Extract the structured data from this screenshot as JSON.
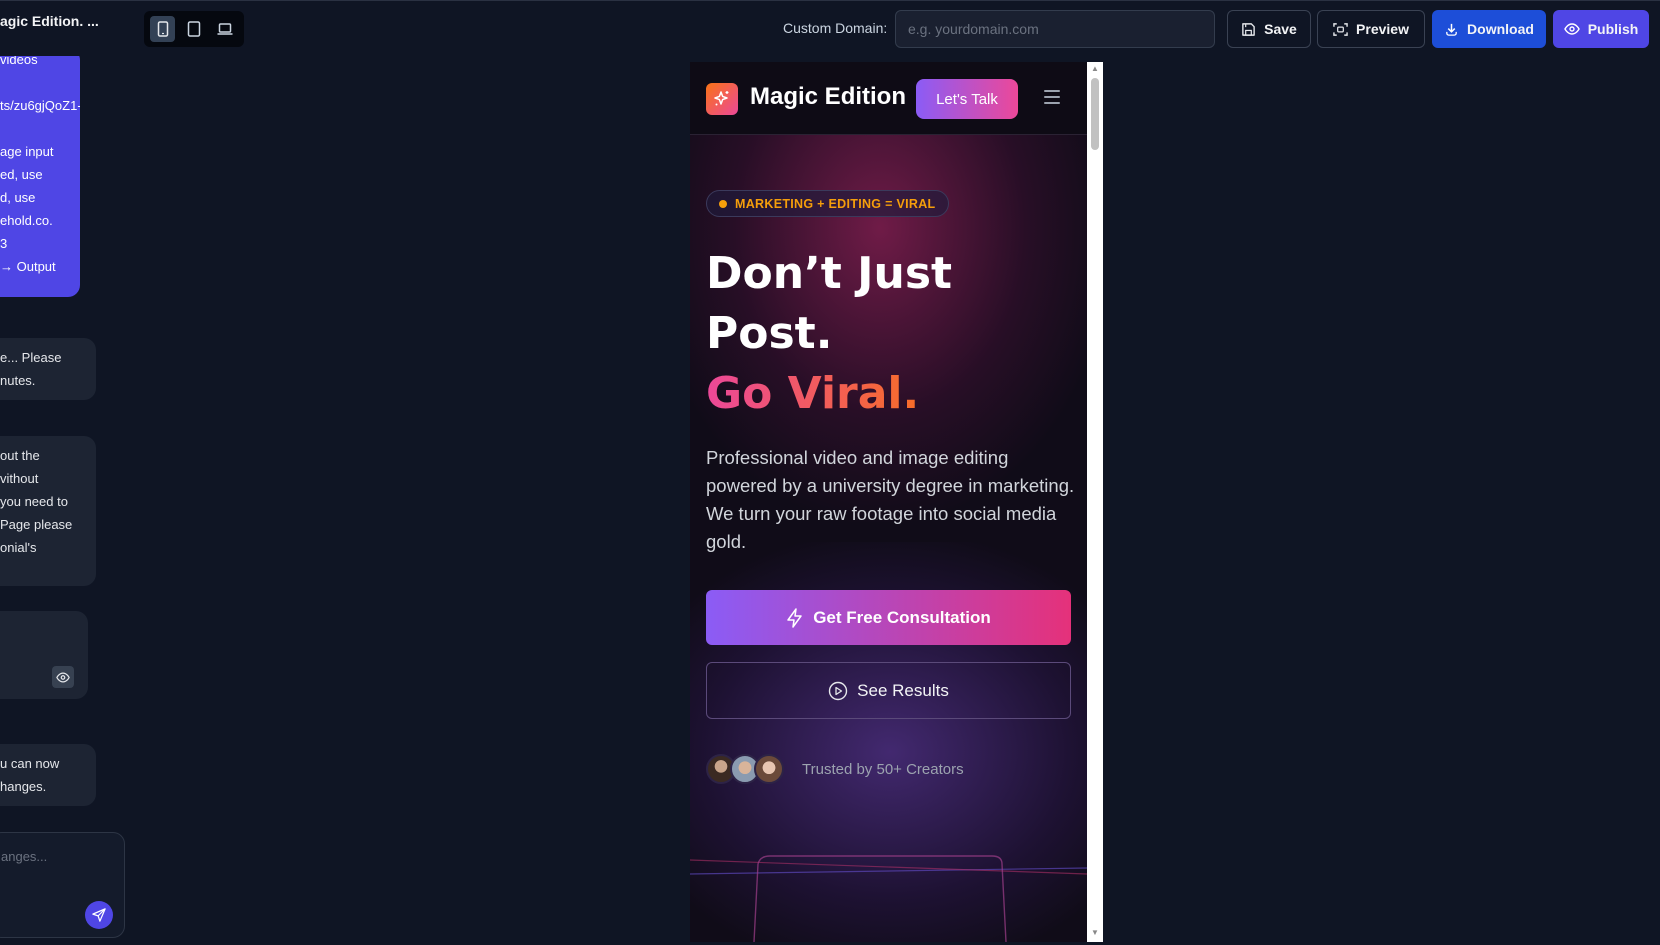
{
  "toolbar": {
    "project_title": "agic Edition. ...",
    "devices": [
      {
        "name": "mobile",
        "icon": "smartphone-icon",
        "active": true
      },
      {
        "name": "tablet",
        "icon": "tablet-icon",
        "active": false
      },
      {
        "name": "desktop",
        "icon": "laptop-icon",
        "active": false
      }
    ],
    "custom_domain_label": "Custom Domain:",
    "custom_domain_placeholder": "e.g. yourdomain.com",
    "custom_domain_value": "",
    "save_label": "Save",
    "preview_label": "Preview",
    "download_label": "Download",
    "publish_label": "Publish"
  },
  "chat": {
    "user_message_lines": [
      "videos",
      "",
      "ts/zu6gjQoZ1-",
      "",
      "age input",
      "ed, use",
      "d, use",
      "ehold.co.",
      "3",
      "→ Output"
    ],
    "ai_message_1_lines": [
      "e... Please",
      "nutes."
    ],
    "ai_message_2_lines": [
      "out the",
      "vithout",
      "you need to",
      "Page please",
      "onial's"
    ],
    "ai_message_4_lines": [
      "u can now",
      "hanges."
    ],
    "input_placeholder": "anges..."
  },
  "preview": {
    "brand": "Magic Edition",
    "nav_cta": "Let's Talk",
    "badge": "MARKETING + EDITING = VIRAL",
    "headline_line1": "Don’t Just",
    "headline_line2": "Post.",
    "headline_line3": "Go Viral.",
    "lead": "Professional video and image editing powered by a university degree in marketing. We turn your raw footage into social media gold.",
    "primary_cta": "Get Free Consultation",
    "secondary_cta": "See Results",
    "trust_text": "Trusted by 50+ Creators"
  },
  "colors": {
    "app_bg": "#0f1524",
    "accent_blue": "#1d4ed8",
    "accent_purple": "#4f46e5",
    "gradient_pink": "#ec4899",
    "gradient_orange": "#f97316",
    "gradient_violet": "#8b5cf6",
    "badge_amber": "#f59e0b"
  }
}
